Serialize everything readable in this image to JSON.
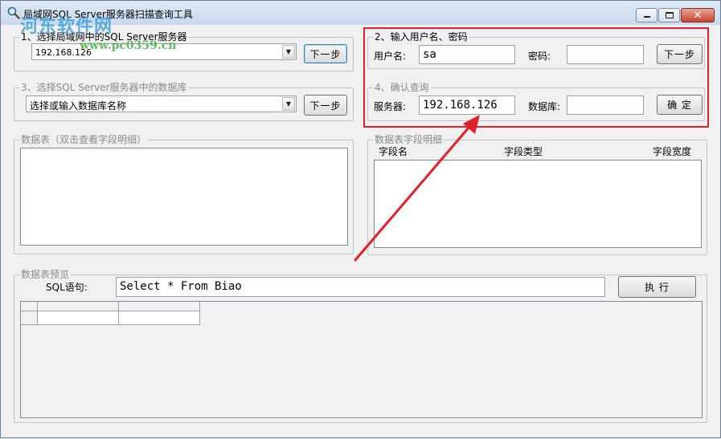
{
  "window": {
    "title": "局域网SQL Server服务器扫描查询工具",
    "watermark": {
      "logo_text": "河东软件网",
      "url": "www.pc0359.cn"
    }
  },
  "section1": {
    "legend": "1、选择局域网中的SQL Server服务器",
    "server_combo_value": "192.168.126",
    "next_label": "下一步"
  },
  "section2": {
    "legend": "2、输入用户名、密码",
    "username_label": "用户名:",
    "username_value": "sa",
    "password_label": "密码:",
    "password_value": "",
    "next_label": "下一步"
  },
  "section3": {
    "legend": "3、选择SQL Server服务器中的数据库",
    "database_combo_value": "选择或输入数据库名称",
    "next_label": "下一步"
  },
  "section4": {
    "legend": "4、确认查询",
    "server_label": "服务器:",
    "server_value": "192.168.126",
    "database_label": "数据库:",
    "database_value": "",
    "confirm_label": "确 定"
  },
  "tables_panel": {
    "legend": "数据表（双击查看字段明细）"
  },
  "fields_panel": {
    "legend": "数据表字段明细",
    "columns": [
      "字段名",
      "字段类型",
      "字段宽度"
    ]
  },
  "preview": {
    "legend": "数据表预览",
    "sql_label": "SQL语句:",
    "sql_value": "Select * From Biao",
    "execute_label": "执 行"
  },
  "colors": {
    "highlight": "#e0202a",
    "accent": "#3c7fb1"
  }
}
